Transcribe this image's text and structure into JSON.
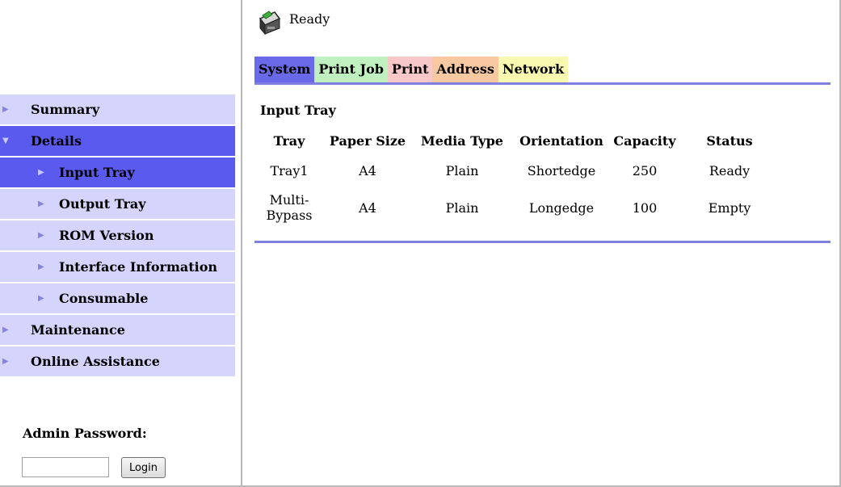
{
  "status": {
    "icon": "printer-icon",
    "text": "Ready"
  },
  "tabs": [
    {
      "label": "System",
      "color": "#6a6ae8",
      "active": true
    },
    {
      "label": "Print Job",
      "color": "#c0f0c0"
    },
    {
      "label": "Print",
      "color": "#f8c8c8"
    },
    {
      "label": "Address",
      "color": "#f8c8a0"
    },
    {
      "label": "Network",
      "color": "#f8f8b0"
    }
  ],
  "sidebar": {
    "items": [
      {
        "label": "Summary"
      },
      {
        "label": "Details"
      },
      {
        "label": "Input Tray"
      },
      {
        "label": "Output Tray"
      },
      {
        "label": "ROM Version"
      },
      {
        "label": "Interface Information"
      },
      {
        "label": "Consumable"
      },
      {
        "label": "Maintenance"
      },
      {
        "label": "Online Assistance"
      }
    ],
    "active_item": "Details",
    "active_subitem": "Input Tray"
  },
  "admin": {
    "label": "Admin Password:",
    "password_value": "",
    "login_label": "Login"
  },
  "main": {
    "section_title": "Input Tray",
    "columns": [
      "Tray",
      "Paper Size",
      "Media Type",
      "Orientation",
      "Capacity",
      "Status"
    ],
    "rows": [
      [
        "Tray1",
        "A4",
        "Plain",
        "Shortedge",
        "250",
        "Ready"
      ],
      [
        "Multi-Bypass",
        "A4",
        "Plain",
        "Longedge",
        "100",
        "Empty"
      ]
    ]
  },
  "colors": {
    "accent": "#5a5aee",
    "menu_bg": "#d4d4fc",
    "rule": "#7f7fdf"
  }
}
